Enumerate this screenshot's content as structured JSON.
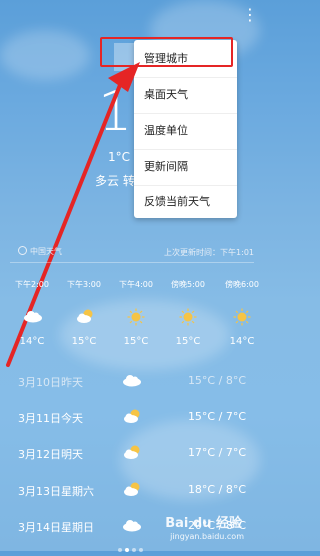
{
  "current": {
    "temp": "1",
    "range": "1°C",
    "condition": "多云 转"
  },
  "menu": {
    "items": [
      "管理城市",
      "桌面天气",
      "温度单位",
      "更新间隔",
      "反馈当前天气"
    ]
  },
  "info": {
    "source": "中国天气",
    "updated": "上次更新时间：下午1:01"
  },
  "hourly": [
    {
      "time": "下午2:00",
      "temp": "14°C",
      "icon": "cloud"
    },
    {
      "time": "下午3:00",
      "temp": "15°C",
      "icon": "partly-cloudy"
    },
    {
      "time": "下午4:00",
      "temp": "15°C",
      "icon": "sun"
    },
    {
      "time": "傍晚5:00",
      "temp": "15°C",
      "icon": "sun"
    },
    {
      "time": "傍晚6:00",
      "temp": "14°C",
      "icon": "sun"
    }
  ],
  "daily": [
    {
      "date": "3月10日昨天",
      "temp": "15°C / 8°C",
      "icon": "cloud"
    },
    {
      "date": "3月11日今天",
      "temp": "15°C / 7°C",
      "icon": "partly-cloudy"
    },
    {
      "date": "3月12日明天",
      "temp": "17°C / 7°C",
      "icon": "partly-cloudy"
    },
    {
      "date": "3月13日星期六",
      "temp": "18°C / 8°C",
      "icon": "partly-cloudy"
    },
    {
      "date": "3月14日星期日",
      "temp": "20°C / 8°C",
      "icon": "cloud"
    }
  ],
  "watermark": {
    "logo": "Bai du 经验",
    "url": "jingyan.baidu.com"
  },
  "colors": {
    "highlight": "#e52525",
    "arrow": "#e52525",
    "sun": "#f6c445"
  }
}
